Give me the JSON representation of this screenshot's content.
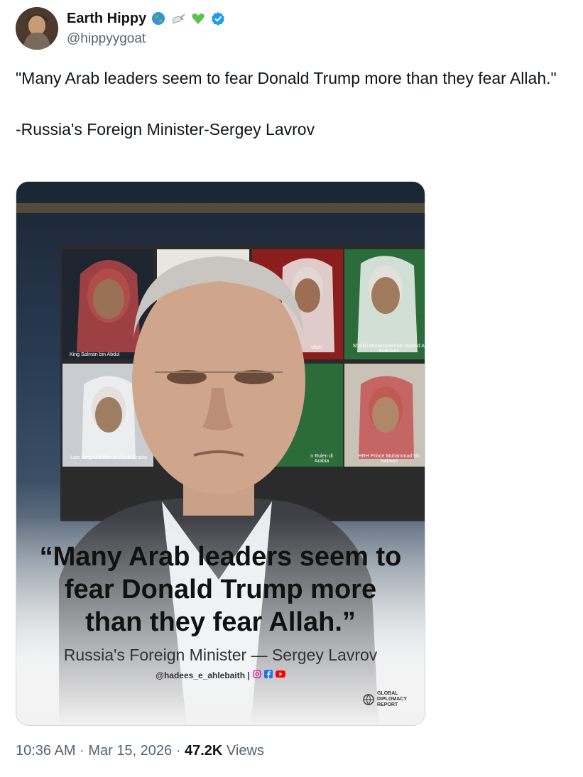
{
  "author": {
    "display_name": "Earth Hippy",
    "handle": "@hippyygoat",
    "emojis": [
      "globe-emoji",
      "dove-emoji",
      "green-heart-emoji",
      "verified-badge"
    ]
  },
  "tweet": {
    "line1": "\"Many Arab leaders seem to fear Donald Trump more than they fear Allah.\"",
    "line2": "-Russia's Foreign Minister-Sergey Lavrov"
  },
  "media": {
    "caption_names": [
      "King Salman bin Abdul",
      "ullah",
      "Shaikh Mohammed bin Rashid Al Maktoum",
      "Late King Abdullah of Saudi Arabia",
      "n Rulen di Arabia",
      "HRH Prince Muhammad bin Salman"
    ],
    "headline": "“Many Arab leaders seem to fear Donald Trump more than they fear Allah.”",
    "attribution": "Russia's Foreign Minister — Sergey Lavrov",
    "social_handle": "@hadees_e_ahlebaith |",
    "logo_text": "GLOBAL DIPLOMACY REPORT"
  },
  "meta": {
    "time": "10:36 AM",
    "separator": "·",
    "date": "Mar 15, 2026",
    "views_count": "47.2K",
    "views_label": "Views"
  }
}
